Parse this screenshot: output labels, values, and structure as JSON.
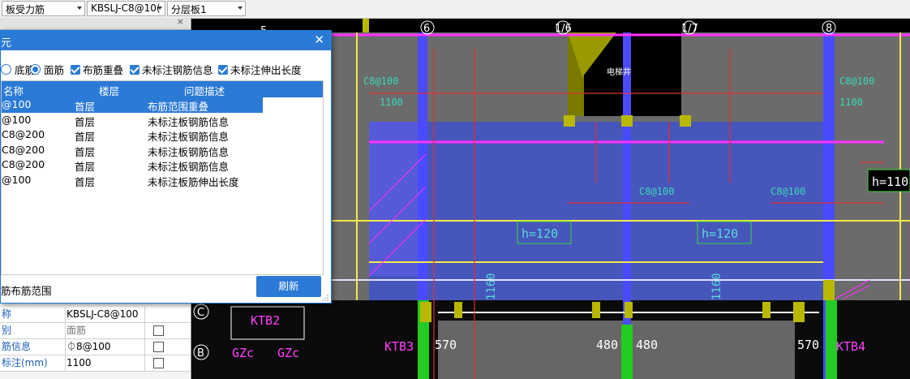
{
  "toolbar": {
    "combo1": "板受力筋",
    "combo2": "KBSLJ-C8@10(",
    "combo3": "分层板1"
  },
  "cad": {
    "axis_top": [
      "5",
      "6",
      "1/6",
      "1/7",
      "8"
    ],
    "axis_left": [
      "C",
      "B"
    ],
    "room_label": "电梯井",
    "h_labels": [
      "h=120",
      "h=120",
      "h=110"
    ],
    "dims": [
      "570",
      "480",
      "480",
      "570"
    ],
    "beams": [
      "KTB2",
      "KTB3",
      "KTB4"
    ],
    "columns": [
      "GZc",
      "GZc"
    ],
    "vertical_dims": [
      "1160",
      "1160"
    ],
    "rebar_labels": [
      "C8@100",
      "C8@100",
      "1100",
      "1100",
      "C8@100",
      "C8@100"
    ]
  },
  "left_panel": {
    "props": [
      {
        "key": "称",
        "value": "KBSLJ-C8@100",
        "checkbox": false
      },
      {
        "key": "别",
        "value": "面筋",
        "checkbox": true
      },
      {
        "key": "筋信息",
        "value": "⏀8@100",
        "checkbox": true
      },
      {
        "key": "标注(mm)",
        "value": "1100",
        "checkbox": true
      }
    ]
  },
  "dialog": {
    "title": "元",
    "close": "✕",
    "options": {
      "bottom_rebar": "底筋",
      "top_rebar": "面筋",
      "overlap": "布筋重叠",
      "unmarked_info": "未标注钢筋信息",
      "unmarked_ext": "未标注伸出长度"
    },
    "columns": [
      "名称",
      "楼层",
      "问题描述"
    ],
    "rows": [
      {
        "name": "@100",
        "floor": "首层",
        "desc": "布筋范围重叠"
      },
      {
        "name": "@100",
        "floor": "首层",
        "desc": "未标注板钢筋信息"
      },
      {
        "name": "C8@200",
        "floor": "首层",
        "desc": "未标注板钢筋信息"
      },
      {
        "name": "C8@200",
        "floor": "首层",
        "desc": "未标注板钢筋信息"
      },
      {
        "name": "C8@200",
        "floor": "首层",
        "desc": "未标注板钢筋信息"
      },
      {
        "name": "@100",
        "floor": "首层",
        "desc": "未标注板筋伸出长度"
      }
    ],
    "footer": "筋布筋范围",
    "refresh": "刷新"
  }
}
